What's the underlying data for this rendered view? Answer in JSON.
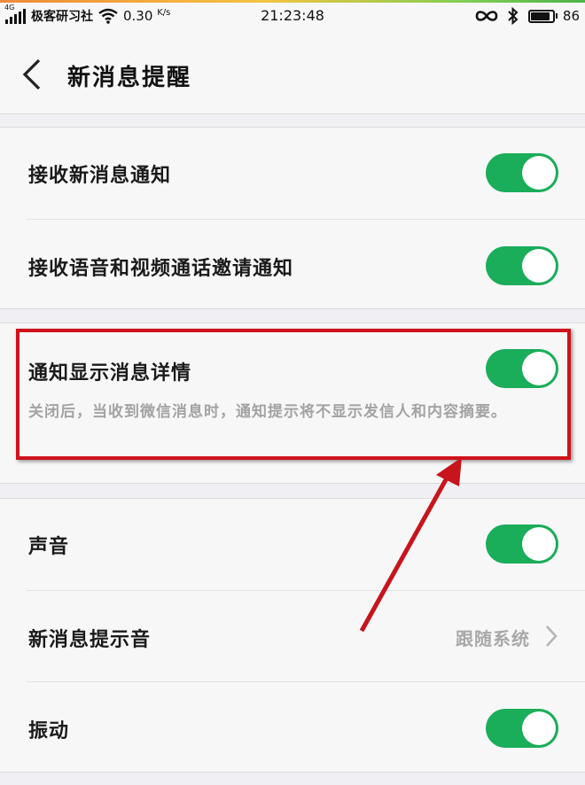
{
  "status_bar": {
    "network_tag": "4G",
    "carrier": "极客研习社",
    "speed": "0.30",
    "speed_unit": "K/s",
    "time": "21:23:48",
    "battery_level": "86",
    "battery_fraction": 0.86
  },
  "header": {
    "title": "新消息提醒",
    "back_icon": "chevron-left-icon"
  },
  "sections": [
    {
      "rows": [
        {
          "label": "接收新消息通知",
          "toggle_on": true
        },
        {
          "label": "接收语音和视频通话邀请通知",
          "toggle_on": true
        }
      ]
    },
    {
      "rows": [
        {
          "label": "通知显示消息详情",
          "toggle_on": true,
          "description": "关闭后，当收到微信消息时，通知提示将不显示发信人和内容摘要。"
        }
      ]
    },
    {
      "rows": [
        {
          "label": "声音",
          "toggle_on": true
        },
        {
          "label": "新消息提示音",
          "value": "跟随系统"
        },
        {
          "label": "振动",
          "toggle_on": true
        }
      ]
    }
  ],
  "colors": {
    "toggle_on": "#1aad5a",
    "highlight": "#d0121b",
    "background": "#efeff4"
  }
}
